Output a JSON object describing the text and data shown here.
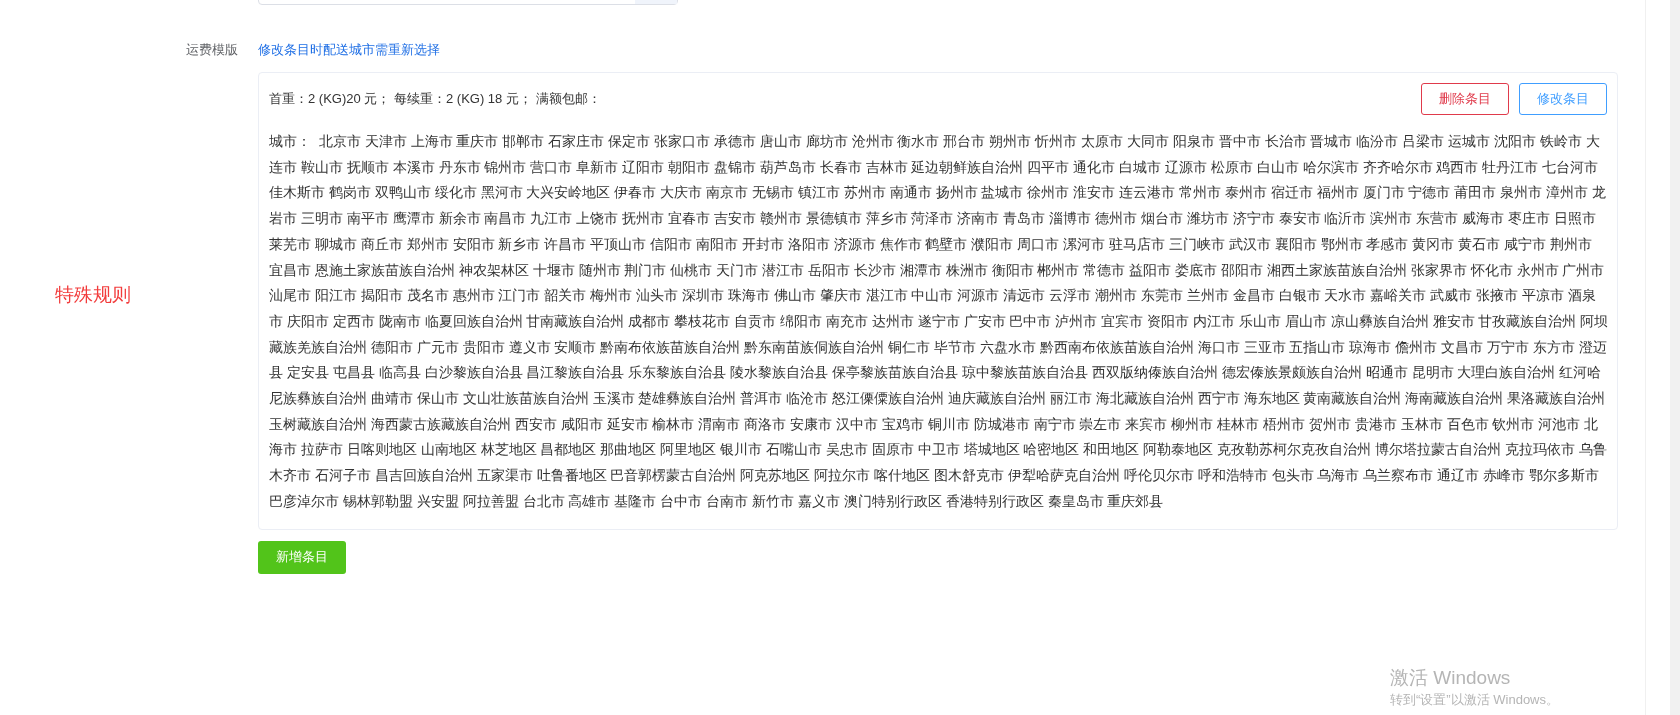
{
  "template": {
    "label": "运费模版",
    "link": "修改条目时配送城市需重新选择"
  },
  "side_label": "特殊规则",
  "rules": [
    {
      "summary": "首重：2 (KG)20 元；  每续重：2 (KG) 18 元；  满额包邮：",
      "buttons": [
        {
          "label": "删除条目",
          "kind": "danger"
        },
        {
          "label": "修改条目",
          "kind": "primary"
        }
      ],
      "city_lines": [
        "城市：  北京市 天津市 上海市 重庆市 邯郸市 石家庄市 保定市 张家口市 承德市 唐山市 廊坊市 沧州市 衡水市 邢台市 朔州市 忻州市 太原市 大同市 阳泉市 晋中市 长治市 晋城市 临汾市 吕梁市 运城市 沈阳市 铁岭市 大",
        "连市 鞍山市 抚顺市 本溪市 丹东市 锦州市 营口市 阜新市 辽阳市 朝阳市 盘锦市 葫芦岛市 长春市 吉林市 延边朝鲜族自治州 四平市 通化市 白城市 辽源市 松原市 白山市 哈尔滨市 齐齐哈尔市 鸡西市 牡丹江市 七台河市",
        "佳木斯市 鹤岗市 双鸭山市 绥化市 黑河市 大兴安岭地区 伊春市 大庆市 南京市 无锡市 镇江市 苏州市 南通市 扬州市 盐城市 徐州市 淮安市 连云港市 常州市 泰州市 宿迁市 福州市 厦门市 宁德市 莆田市 泉州市 漳州市 龙",
        "岩市 三明市 南平市 鹰潭市 新余市 南昌市 九江市 上饶市 抚州市 宜春市 吉安市 赣州市 景德镇市 萍乡市 菏泽市 济南市 青岛市 淄博市 德州市 烟台市 潍坊市 济宁市 泰安市 临沂市 滨州市 东营市 威海市 枣庄市 日照市",
        "莱芜市 聊城市 商丘市 郑州市 安阳市 新乡市 许昌市 平顶山市 信阳市 南阳市 开封市 洛阳市 济源市 焦作市 鹤壁市 濮阳市 周口市 漯河市 驻马店市 三门峡市 武汉市 襄阳市 鄂州市 孝感市 黄冈市 黄石市 咸宁市 荆州市",
        "宜昌市 恩施土家族苗族自治州 神农架林区 十堰市 随州市 荆门市 仙桃市 天门市 潜江市 岳阳市 长沙市 湘潭市 株洲市 衡阳市 郴州市 常德市 益阳市 娄底市 邵阳市 湘西土家族苗族自治州 张家界市 怀化市 永州市 广州市",
        "汕尾市 阳江市 揭阳市 茂名市 惠州市 江门市 韶关市 梅州市 汕头市 深圳市 珠海市 佛山市 肇庆市 湛江市 中山市 河源市 清远市 云浮市 潮州市 东莞市 兰州市 金昌市 白银市 天水市 嘉峪关市 武威市 张掖市 平凉市 酒泉",
        "市 庆阳市 定西市 陇南市 临夏回族自治州 甘南藏族自治州 成都市 攀枝花市 自贡市 绵阳市 南充市 达州市 遂宁市 广安市 巴中市 泸州市 宜宾市 资阳市 内江市 乐山市 眉山市 凉山彝族自治州 雅安市 甘孜藏族自治州 阿坝",
        "藏族羌族自治州 德阳市 广元市 贵阳市 遵义市 安顺市 黔南布依族苗族自治州 黔东南苗族侗族自治州 铜仁市 毕节市 六盘水市 黔西南布依族苗族自治州 海口市 三亚市 五指山市 琼海市 儋州市 文昌市 万宁市 东方市 澄迈",
        "县 定安县 屯昌县 临高县 白沙黎族自治县 昌江黎族自治县 乐东黎族自治县 陵水黎族自治县 保亭黎族苗族自治县 琼中黎族苗族自治县 西双版纳傣族自治州 德宏傣族景颇族自治州 昭通市 昆明市 大理白族自治州 红河哈",
        "尼族彝族自治州 曲靖市 保山市 文山壮族苗族自治州 玉溪市 楚雄彝族自治州 普洱市 临沧市 怒江傈僳族自治州 迪庆藏族自治州 丽江市 海北藏族自治州 西宁市 海东地区 黄南藏族自治州 海南藏族自治州 果洛藏族自治州",
        "玉树藏族自治州 海西蒙古族藏族自治州 西安市 咸阳市 延安市 榆林市 渭南市 商洛市 安康市 汉中市 宝鸡市 铜川市 防城港市 南宁市 崇左市 来宾市 柳州市 桂林市 梧州市 贺州市 贵港市 玉林市 百色市 钦州市 河池市 北",
        "海市 拉萨市 日喀则地区 山南地区 林芝地区 昌都地区 那曲地区 阿里地区 银川市 石嘴山市 吴忠市 固原市 中卫市 塔城地区 哈密地区 和田地区 阿勒泰地区 克孜勒苏柯尔克孜自治州 博尔塔拉蒙古自治州 克拉玛依市 乌鲁",
        "木齐市 石河子市 昌吉回族自治州 五家渠市 吐鲁番地区 巴音郭楞蒙古自治州 阿克苏地区 阿拉尔市 喀什地区 图木舒克市 伊犁哈萨克自治州 呼伦贝尔市 呼和浩特市 包头市 乌海市 乌兰察布市 通辽市 赤峰市 鄂尔多斯市",
        "巴彦淖尔市 锡林郭勒盟 兴安盟 阿拉善盟 台北市 高雄市 基隆市 台中市 台南市 新竹市 嘉义市 澳门特别行政区 香港特别行政区 秦皇岛市 重庆郊县"
      ]
    }
  ],
  "add_button": "新增条目",
  "os_notice": {
    "title": "激活 Windows",
    "subtitle": "转到“设置”以激活 Windows。"
  }
}
